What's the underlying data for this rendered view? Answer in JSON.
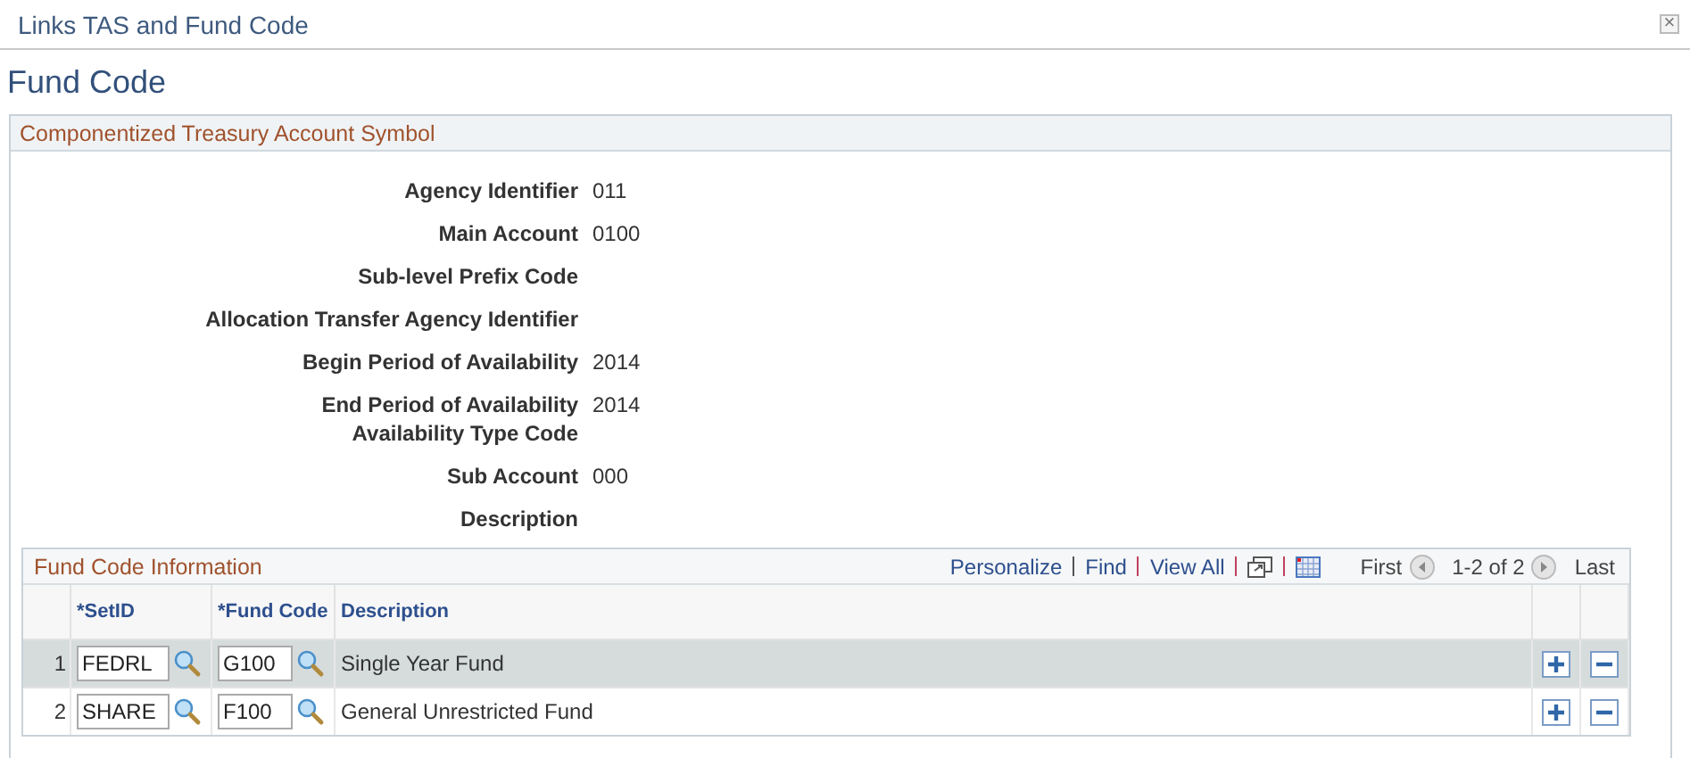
{
  "window": {
    "title": "Links TAS and Fund Code",
    "close": "×"
  },
  "page_title": "Fund Code",
  "section": {
    "title": "Componentized Treasury Account Symbol",
    "fields": [
      {
        "label": "Agency Identifier",
        "value": "011"
      },
      {
        "label": "Main Account",
        "value": "0100"
      },
      {
        "label": "Sub-level Prefix Code"
      },
      {
        "label": "Allocation Transfer Agency Identifier"
      },
      {
        "label": "Begin Period of Availability",
        "value": "2014"
      },
      {
        "label": "End Period of Availability",
        "value": "2014"
      },
      {
        "label": "Availability Type Code",
        "compact": true
      },
      {
        "label": "Sub Account",
        "value": "000"
      },
      {
        "label": "Description"
      }
    ]
  },
  "grid": {
    "title": "Fund Code Information",
    "links": [
      "Personalize",
      "Find",
      "View All"
    ],
    "nav": {
      "first": "First",
      "range": "1-2 of 2",
      "last": "Last"
    },
    "columns": [
      "*SetID",
      "*Fund Code",
      "Description"
    ],
    "rows": [
      {
        "number": "1",
        "setid": "FEDRL",
        "fund_code": "G100",
        "description": "Single Year Fund",
        "selected": true
      },
      {
        "number": "2",
        "setid": "SHARE",
        "fund_code": "F100",
        "description": "General Unrestricted Fund",
        "selected": false
      }
    ]
  }
}
